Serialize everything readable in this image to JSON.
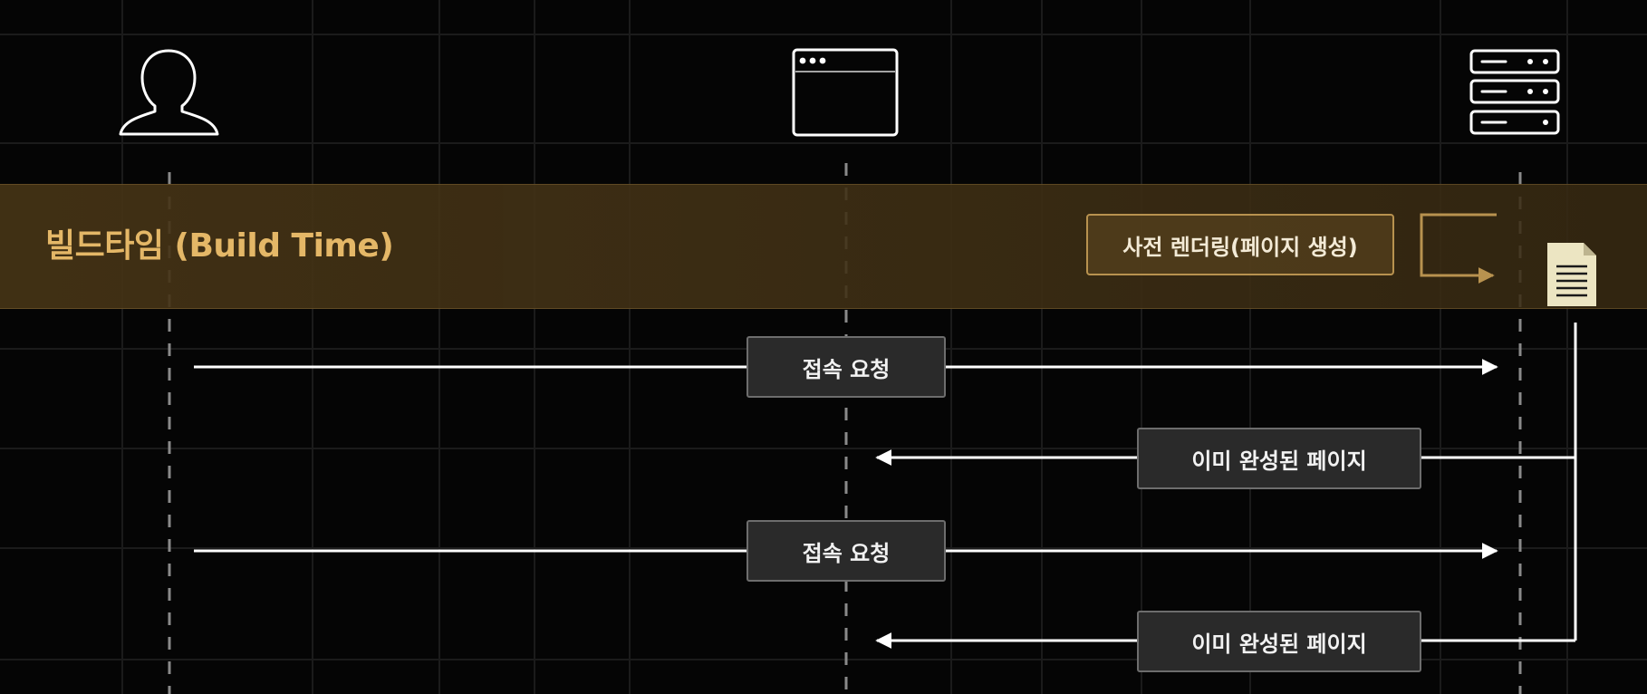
{
  "build_phase": {
    "title": "빌드타임 (Build Time)",
    "prerender_label": "사전 렌더링(페이지 생성)"
  },
  "participants": [
    {
      "role": "user",
      "icon": "user-icon"
    },
    {
      "role": "browser",
      "icon": "browser-window-icon"
    },
    {
      "role": "server",
      "icon": "server-icon"
    }
  ],
  "artifact": {
    "icon": "document-icon"
  },
  "messages": [
    {
      "label": "접속 요청",
      "direction": "user-to-server"
    },
    {
      "label": "이미 완성된 페이지",
      "direction": "server-to-browser"
    },
    {
      "label": "접속 요청",
      "direction": "user-to-server"
    },
    {
      "label": "이미 완성된 페이지",
      "direction": "server-to-browser"
    }
  ],
  "colors": {
    "background": "#050505",
    "band": "#46341a",
    "band_title": "#e4b767",
    "prerender_border": "#b8924f",
    "document": "#ece5c2",
    "arrow": "#ffffff",
    "message_box": "#2a2a2a",
    "message_border": "#6d6d6d"
  }
}
